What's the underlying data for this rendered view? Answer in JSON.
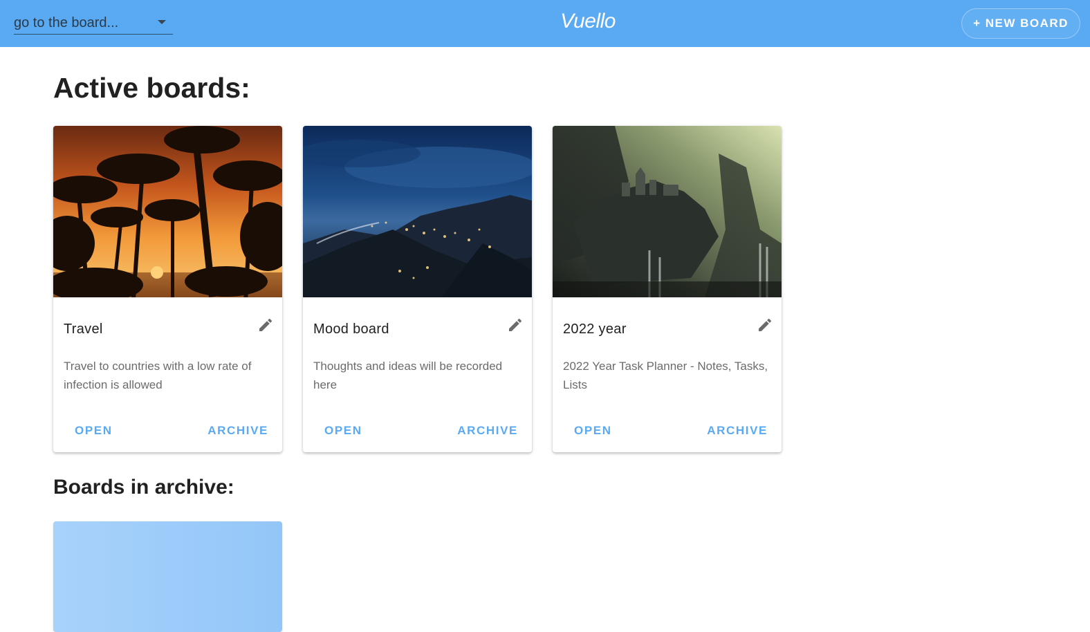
{
  "header": {
    "board_select_placeholder": "go to the board...",
    "logo": "Vuello",
    "new_board_label": "+ NEW BOARD"
  },
  "sections": {
    "active_title": "Active boards:",
    "archive_title": "Boards in archive:"
  },
  "active_boards": [
    {
      "title": "Travel",
      "description": "Travel to countries with a low rate of infection is allowed",
      "open_label": "OPEN",
      "archive_label": "ARCHIVE"
    },
    {
      "title": "Mood board",
      "description": "Thoughts and ideas will be recorded here",
      "open_label": "OPEN",
      "archive_label": "ARCHIVE"
    },
    {
      "title": "2022 year",
      "description": "2022 Year Task Planner - Notes, Tasks, Lists",
      "open_label": "OPEN",
      "archive_label": "ARCHIVE"
    }
  ],
  "colors": {
    "primary": "#5aaaf3",
    "archive_card": "#a8d2fb"
  },
  "icons": {
    "dropdown": "caret-down-icon",
    "edit": "pencil-icon"
  }
}
